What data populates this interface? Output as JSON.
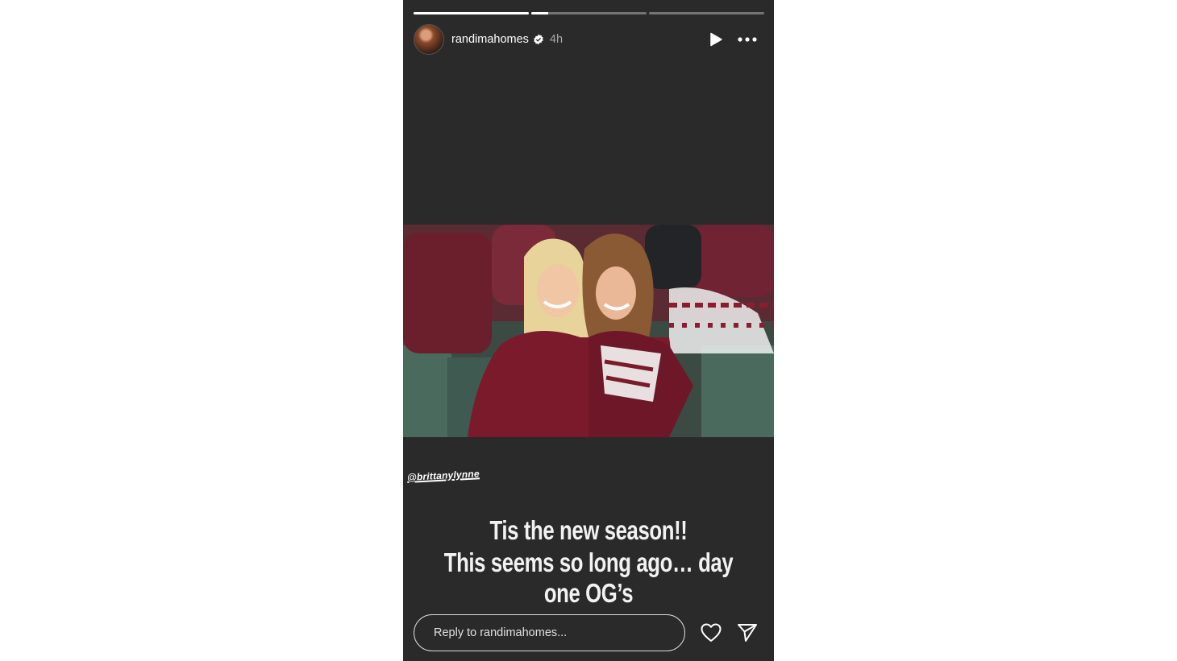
{
  "story": {
    "progress_segments": [
      {
        "filled": 1.0
      },
      {
        "filled": 0.15
      },
      {
        "filled": 0.0
      }
    ],
    "user": {
      "username": "randimahomes",
      "verified": true,
      "time_ago": "4h"
    },
    "controls": {
      "play_icon": "play-icon",
      "more_icon": "more-options-icon"
    },
    "mention": "@brittanylynne",
    "caption_lines": [
      "Tis the new season!!",
      "This seems so long ago… day one OG’s"
    ],
    "reply": {
      "placeholder": "Reply to randimahomes..."
    },
    "actions": {
      "like_icon": "heart-icon",
      "share_icon": "send-icon"
    }
  },
  "colors": {
    "story_background": "#2a2a2b",
    "page_background": "#ffffff",
    "text": "#ffffff",
    "muted_text": "#a8a8a8"
  }
}
